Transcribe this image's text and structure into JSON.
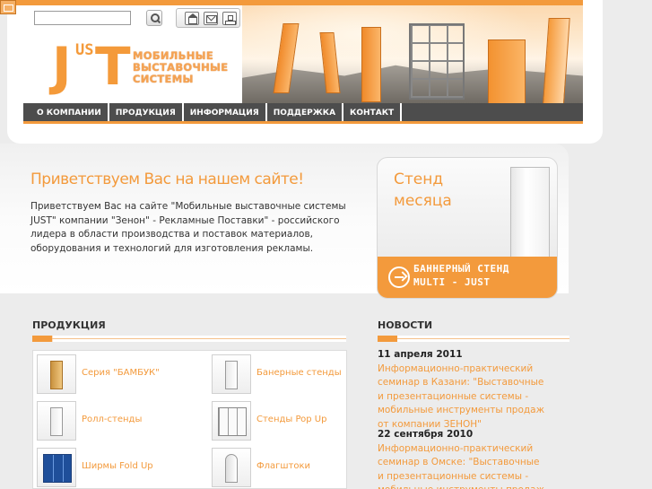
{
  "search": {
    "placeholder": ""
  },
  "brand": {
    "logo_j": "J",
    "logo_us": "US",
    "logo_t": "T",
    "tagline_line1": "МОБИЛЬНЫЕ",
    "tagline_line2": "ВЫСТАВОЧНЫЕ",
    "tagline_line3": "СИСТЕМЫ"
  },
  "nav": {
    "items": [
      {
        "label": "О КОМПАНИИ"
      },
      {
        "label": "ПРОДУКЦИЯ"
      },
      {
        "label": "ИНФОРМАЦИЯ"
      },
      {
        "label": "ПОДДЕРЖКА"
      },
      {
        "label": "КОНТАКТ"
      }
    ]
  },
  "welcome": {
    "title": "Приветствуем Вас на нашем сайте!",
    "text": "Приветствуем Вас на сайте \"Мобильные выставочные системы JUST\" компании \"Зенон\" - Рекламные Поставки\" - российского лидера в области производства и поставок материалов, оборудования и технологий для изготовления рекламы."
  },
  "promo": {
    "title_line1": "Стенд",
    "title_line2": "месяца",
    "caption_line1": "БАННЕРНЫЙ СТЕНД",
    "caption_line2": "MULTI - JUST"
  },
  "products": {
    "title": "ПРОДУКЦИЯ",
    "items": [
      {
        "label": "Серия \"БАМБУК\""
      },
      {
        "label": "Банерные стенды"
      },
      {
        "label": "Ролл-стенды"
      },
      {
        "label": "Стенды Pop Up"
      },
      {
        "label": "Ширмы Fold Up"
      },
      {
        "label": "Флагштоки"
      }
    ]
  },
  "news": {
    "title": "НОВОСТИ",
    "items": [
      {
        "date": "11 апреля 2011",
        "text": "Информационно-практический семинар в Казани: \"Выставочные и презентационные системы - мобильные инструменты продаж от компании ЗЕНОН\""
      },
      {
        "date": "22 сентября 2010",
        "text": "Информационно-практический семинар в Омске: \"Выставочные и презентационные системы - мобильные инструменты продаж от компании ЗЕНОН\""
      }
    ]
  },
  "colors": {
    "accent": "#f39a3c",
    "nav_bg": "#4d4d4d",
    "page_bg": "#ececec"
  }
}
